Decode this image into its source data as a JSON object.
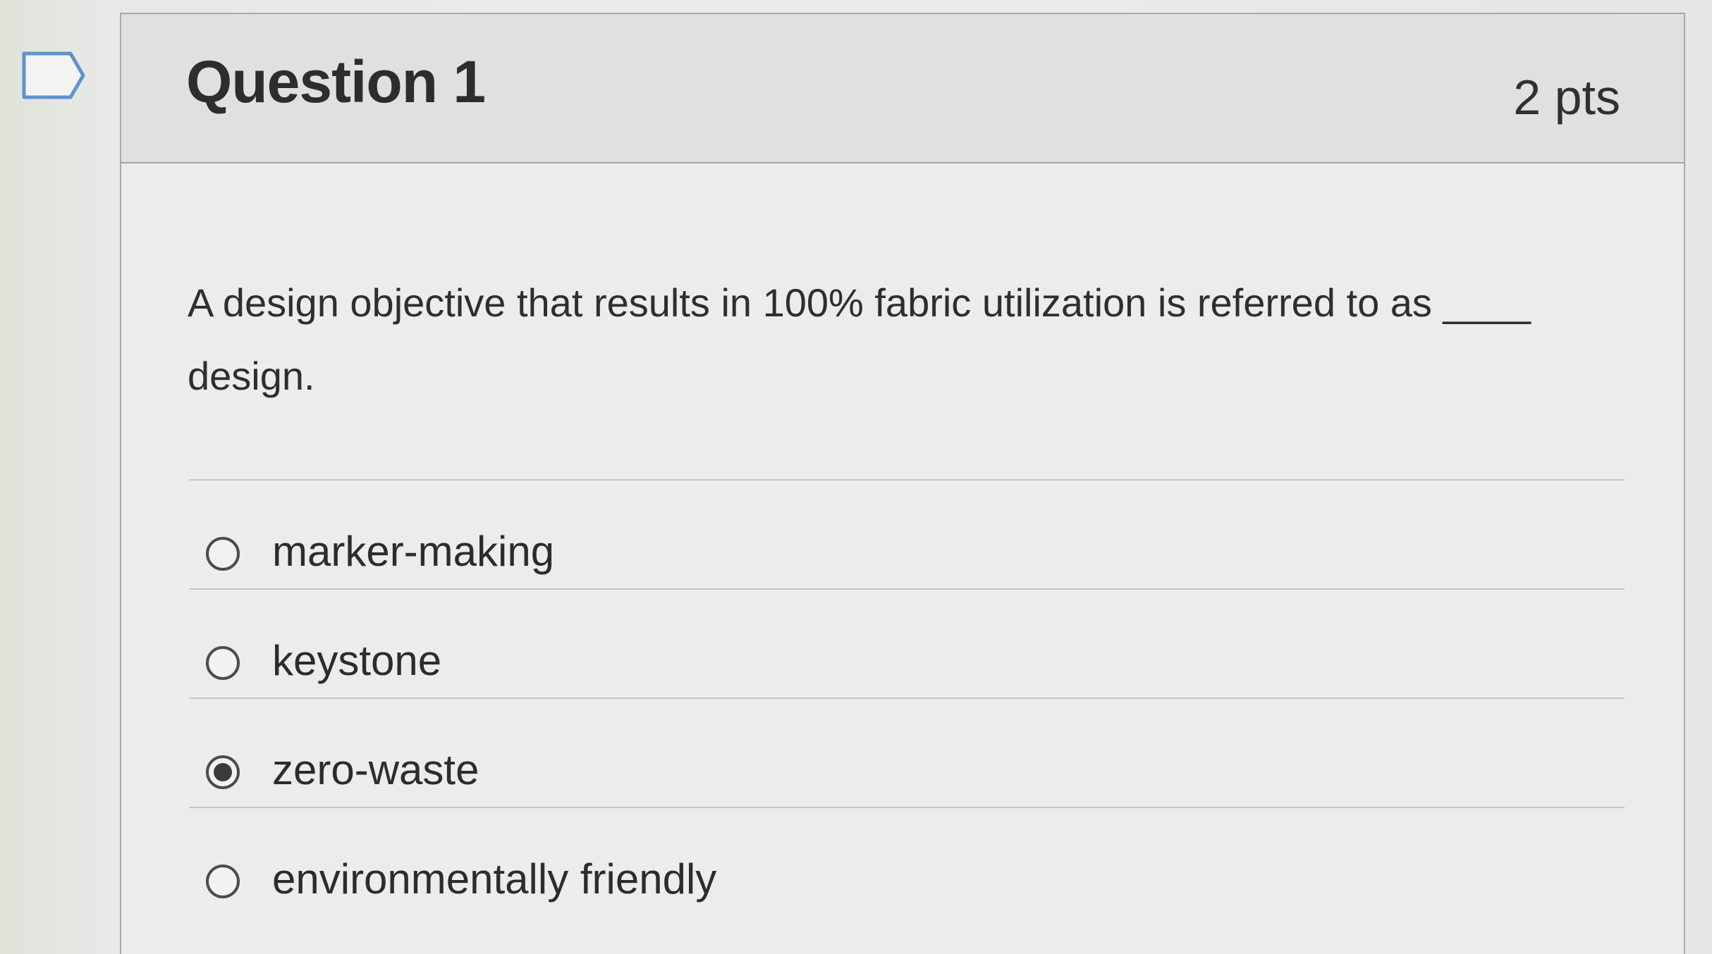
{
  "question": {
    "title": "Question 1",
    "points": "2 pts",
    "text": "A design objective that results in 100% fabric utilization is referred to as ____ design."
  },
  "answers": [
    {
      "label": "marker-making",
      "selected": false
    },
    {
      "label": "keystone",
      "selected": false
    },
    {
      "label": "zero-waste",
      "selected": true
    },
    {
      "label": "environmentally friendly",
      "selected": false
    }
  ],
  "icons": {
    "flag": "flag-question-icon",
    "radio": "radio-button-icon"
  },
  "colors": {
    "text": "#2c2d2e",
    "header_bg": "#e0e0de",
    "border": "#a9aaa8"
  }
}
